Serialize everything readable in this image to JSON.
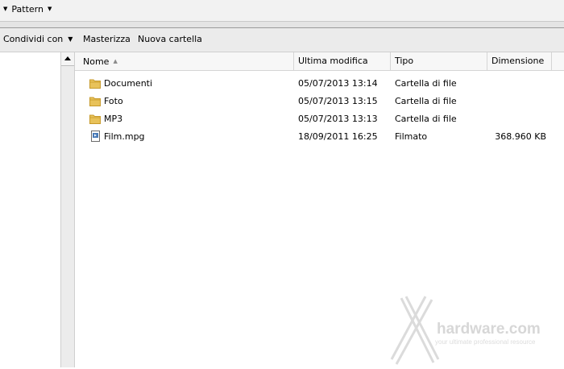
{
  "breadcrumb": {
    "label": "Pattern"
  },
  "toolbar": {
    "share_label": "Condividi con",
    "burn_label": "Masterizza",
    "new_folder_label": "Nuova cartella"
  },
  "columns": {
    "name": "Nome",
    "modified": "Ultima modifica",
    "type": "Tipo",
    "size": "Dimensione"
  },
  "files": [
    {
      "icon": "folder-icon",
      "name": "Documenti",
      "modified": "05/07/2013 13:14",
      "type": "Cartella di file",
      "size": ""
    },
    {
      "icon": "folder-icon",
      "name": "Foto",
      "modified": "05/07/2013 13:15",
      "type": "Cartella di file",
      "size": ""
    },
    {
      "icon": "folder-icon",
      "name": "MP3",
      "modified": "05/07/2013 13:13",
      "type": "Cartella di file",
      "size": ""
    },
    {
      "icon": "video-file-icon",
      "name": "Film.mpg",
      "modified": "18/09/2011 16:25",
      "type": "Filmato",
      "size": "368.960 KB"
    }
  ],
  "watermark": {
    "brand": "hardware",
    "domain": ".com",
    "tagline": "your ultimate professional resource"
  },
  "colors": {
    "folder": "#e8c25a",
    "folder_dark": "#c79a2a",
    "video_icon": "#4a7bb7"
  }
}
